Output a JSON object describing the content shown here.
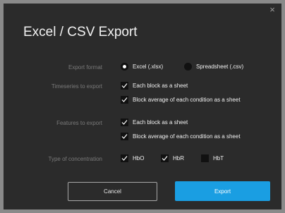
{
  "dialog": {
    "title": "Excel / CSV Export",
    "close_glyph": "×"
  },
  "export_format": {
    "label": "Export format",
    "options": [
      {
        "label": "Excel (.xlsx)",
        "selected": true
      },
      {
        "label": "Spreadsheet (.csv)",
        "selected": false
      }
    ]
  },
  "timeseries": {
    "label": "Timeseries to export",
    "options": [
      {
        "label": "Each block as a sheet",
        "checked": true
      },
      {
        "label": "Block average of each condition as a sheet",
        "checked": true
      }
    ]
  },
  "features": {
    "label": "Features to export",
    "options": [
      {
        "label": "Each block as a sheet",
        "checked": true
      },
      {
        "label": "Block average of each condition as a sheet",
        "checked": true
      }
    ]
  },
  "concentration": {
    "label": "Type of concentration",
    "options": [
      {
        "label": "HbO",
        "checked": true
      },
      {
        "label": "HbR",
        "checked": true
      },
      {
        "label": "HbT",
        "checked": false
      }
    ]
  },
  "buttons": {
    "cancel": "Cancel",
    "export": "Export"
  },
  "colors": {
    "accent": "#1a9ee2",
    "dialog_bg": "#2b2b2b",
    "label_text": "#7a7a7a"
  },
  "icons": {
    "close": "close-icon",
    "check": "checkmark-icon"
  }
}
